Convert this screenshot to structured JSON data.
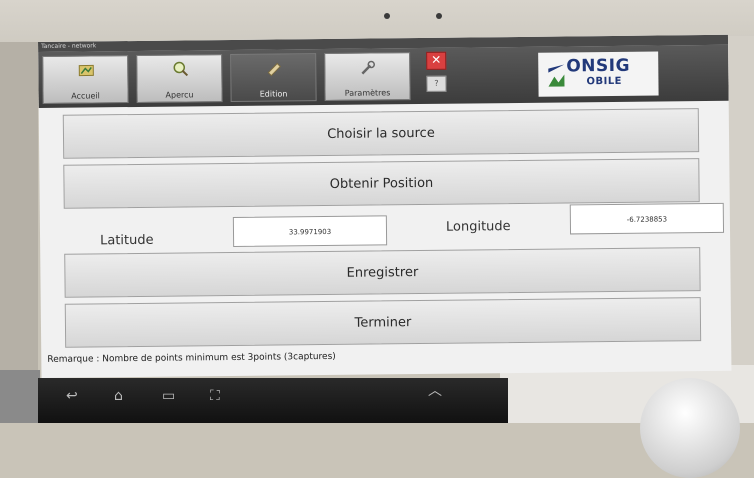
{
  "window": {
    "title": "Tancaire - network"
  },
  "toolbar": {
    "buttons": [
      {
        "label": "Accueil",
        "icon": "home-map-icon"
      },
      {
        "label": "Apercu",
        "icon": "magnifier-icon"
      },
      {
        "label": "Edition",
        "icon": "edit-icon",
        "active": true
      },
      {
        "label": "Paramètres",
        "icon": "tools-icon"
      }
    ],
    "close_glyph": "✕",
    "help_glyph": "?"
  },
  "logo": {
    "line1": "ONSIG",
    "line2": "OBILE"
  },
  "main": {
    "choose_source_label": "Choisir la source",
    "get_position_label": "Obtenir Position",
    "latitude_label": "Latitude",
    "latitude_value": "33.9971903",
    "longitude_label": "Longitude",
    "longitude_value": "-6.7238853",
    "save_label": "Enregistrer",
    "finish_label": "Terminer",
    "remark": "Remarque : Nombre de points minimum est 3points (3captures)"
  },
  "colors": {
    "accent": "#22397a",
    "close": "#d94040"
  }
}
